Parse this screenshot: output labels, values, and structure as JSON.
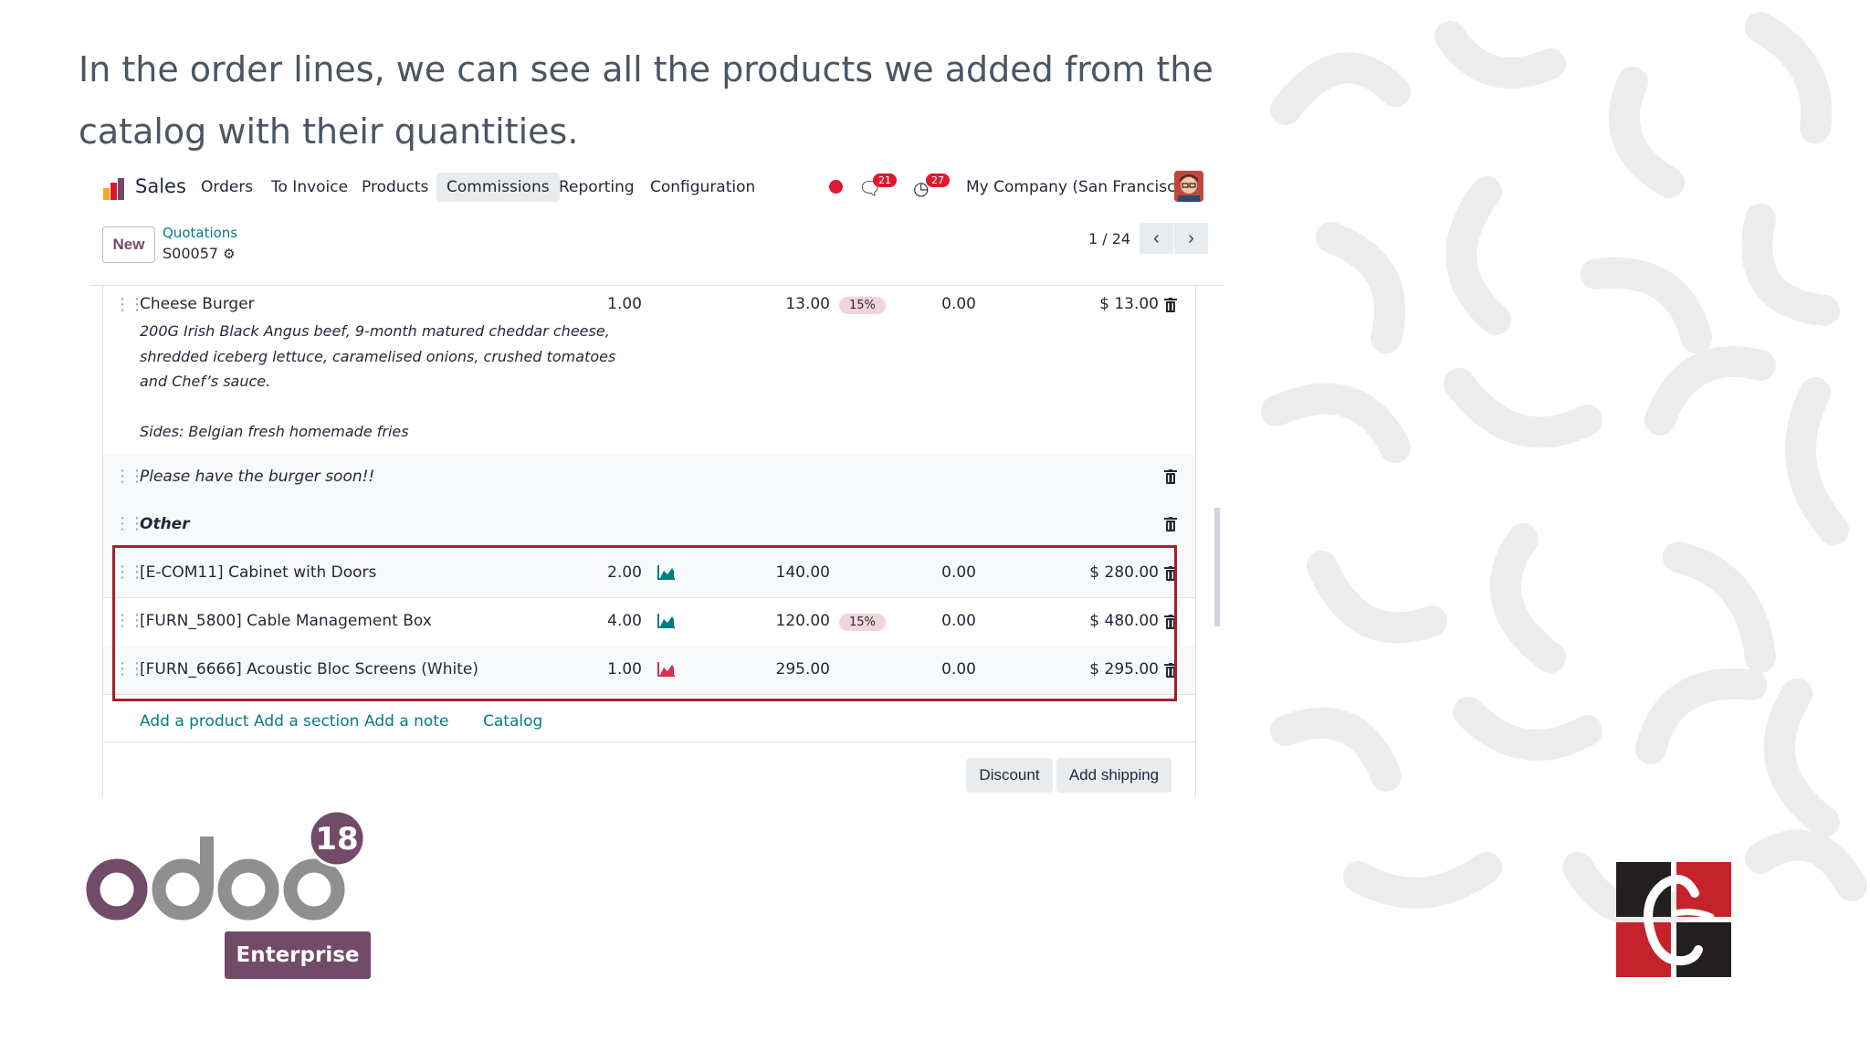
{
  "caption": "In the order lines, we can see all the products we added from the catalog with their quantities.",
  "navbar": {
    "app_name": "Sales",
    "menu": [
      "Orders",
      "To Invoice",
      "Products",
      "Commissions",
      "Reporting",
      "Configuration"
    ],
    "active_menu": "Commissions",
    "messages_count": "21",
    "activities_count": "27",
    "company": "My Company (San Francisco)"
  },
  "controlbar": {
    "new_label": "New",
    "breadcrumb_parent": "Quotations",
    "breadcrumb_current": "S00057",
    "pager": "1 / 24"
  },
  "order_lines": [
    {
      "type": "product",
      "name": "Cheese Burger",
      "description": "200G Irish Black Angus beef, 9-month matured cheddar cheese,\nshredded iceberg lettuce, caramelised onions, crushed tomatoes\nand Chef’s sauce.\n\nSides: Belgian fresh homemade fries",
      "quantity": "1.00",
      "unit_price": "13.00",
      "tax": "15%",
      "discount": "0.00",
      "subtotal": "$ 13.00"
    },
    {
      "type": "note",
      "name": "Please have the burger soon!!"
    },
    {
      "type": "section",
      "name": "Other"
    },
    {
      "type": "product",
      "name": "[E-COM11] Cabinet with Doors",
      "quantity": "2.00",
      "forecast": "available",
      "unit_price": "140.00",
      "tax": "",
      "discount": "0.00",
      "subtotal": "$ 280.00"
    },
    {
      "type": "product",
      "name": "[FURN_5800] Cable Management Box",
      "quantity": "4.00",
      "forecast": "available",
      "unit_price": "120.00",
      "tax": "15%",
      "discount": "0.00",
      "subtotal": "$ 480.00"
    },
    {
      "type": "product",
      "name": "[FURN_6666] Acoustic Bloc Screens (White)",
      "quantity": "1.00",
      "forecast": "unavailable",
      "unit_price": "295.00",
      "tax": "",
      "discount": "0.00",
      "subtotal": "$ 295.00"
    }
  ],
  "line_actions": {
    "add_product": "Add a product",
    "add_section": "Add a section",
    "add_note": "Add a note",
    "catalog": "Catalog"
  },
  "footer_buttons": {
    "discount": "Discount",
    "add_shipping": "Add shipping"
  },
  "branding": {
    "odoo_version": "18",
    "odoo_edition": "Enterprise"
  },
  "colors": {
    "odoo_purple": "#714b67",
    "link_teal": "#017e84",
    "highlight_red": "#a51f2e",
    "forecast_available": "#017e84",
    "forecast_unavailable": "#d9304f"
  }
}
